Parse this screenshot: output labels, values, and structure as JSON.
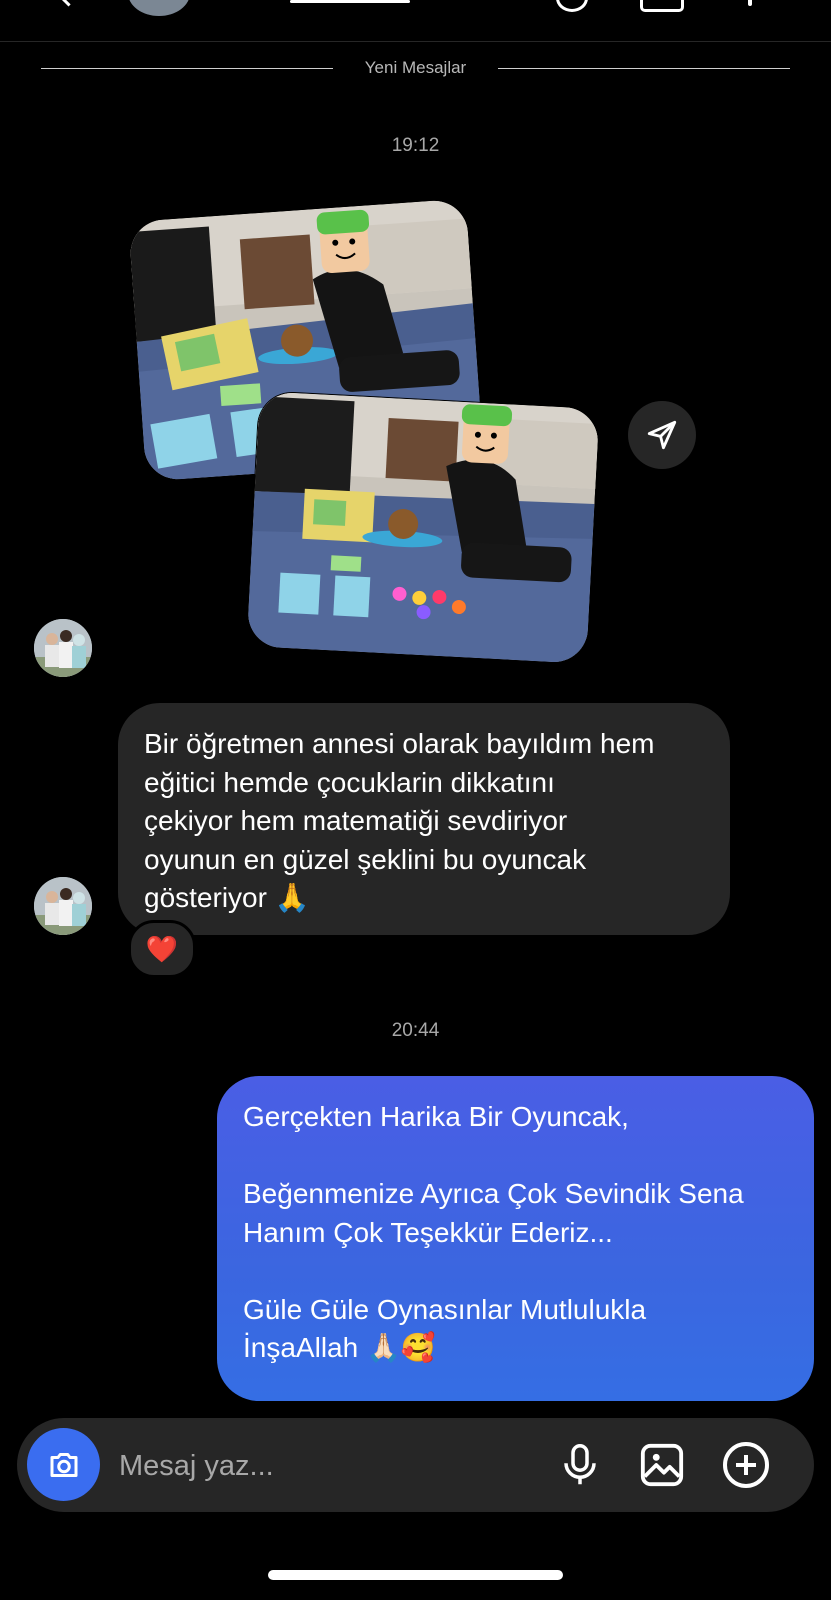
{
  "header": {
    "avatar": "contact-avatar",
    "icons": [
      "back-chevron-icon",
      "phone-icon",
      "video-icon",
      "more-icon"
    ]
  },
  "conversation": {
    "new_messages_label": "Yeni Mesajlar",
    "timestamp_1": "19:12",
    "timestamp_2": "20:44",
    "incoming_message": "Bir öğretmen annesi olarak bayıldım hem\neğitici hemde çocuklarin dikkatını\nçekiyor  hem matematiği sevdiriyor\noyunun en güzel şeklini  bu oyuncak\ngösteriyor 🙏",
    "reaction": "❤️",
    "outgoing_message": "Gerçekten Harika Bir Oyuncak,\n\nBeğenmenize Ayrıca Çok Sevindik Sena\nHanım Çok Teşekkür Ederiz...\n\nGüle Güle Oynasınlar Mutlulukla\nİnşaAllah 🙏🏻🥰"
  },
  "composer": {
    "placeholder": "Mesaj yaz...",
    "icons": [
      "camera-icon",
      "microphone-icon",
      "gallery-icon",
      "add-icon"
    ]
  },
  "colors": {
    "background": "#000000",
    "incoming_bubble": "#262626",
    "outgoing_bubble_top": "#4a5ee5",
    "outgoing_bubble_bottom": "#356ee4",
    "camera_button": "#3a6df0"
  }
}
